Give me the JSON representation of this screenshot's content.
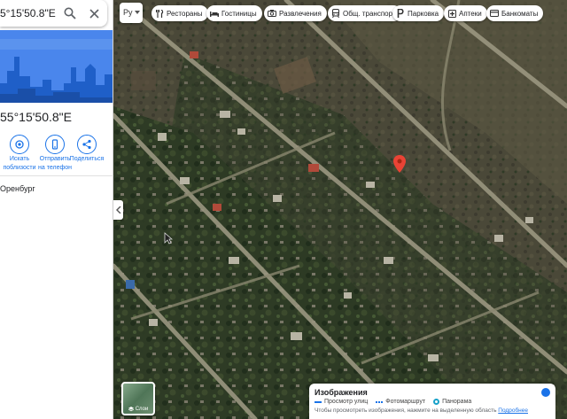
{
  "search": {
    "value": "5°15'50.8\"E"
  },
  "place": {
    "title": "55°15'50.8\"E",
    "address": "Оренбург"
  },
  "actions": [
    {
      "label1": "Искать",
      "label2": "поблизости",
      "icon": "nearby-icon"
    },
    {
      "label1": "Отправить",
      "label2": "на телефон",
      "icon": "phone-icon"
    },
    {
      "label1": "Поделиться",
      "label2": "",
      "icon": "share-icon"
    }
  ],
  "language": "Ру",
  "chips": [
    {
      "label": "Рестораны",
      "icon": "restaurant-icon"
    },
    {
      "label": "Гостиницы",
      "icon": "hotel-icon"
    },
    {
      "label": "Развлечения",
      "icon": "camera-icon"
    },
    {
      "label": "Общ. транспорт",
      "icon": "transit-icon"
    },
    {
      "label": "Парковка",
      "icon": "parking-icon"
    },
    {
      "label": "Аптеки",
      "icon": "pharmacy-icon"
    },
    {
      "label": "Банкоматы",
      "icon": "atm-icon"
    }
  ],
  "layers": {
    "label": "Слои"
  },
  "images_panel": {
    "title": "Изображения",
    "legend": [
      "Просмотр улиц",
      "Фотомаршрут",
      "Панорама"
    ],
    "hint": "Чтобы просмотреть изображения, нажмите на выделенную область",
    "hint_link": "Подробнее"
  },
  "colors": {
    "accent": "#1a73e8",
    "pin": "#ea4335"
  }
}
